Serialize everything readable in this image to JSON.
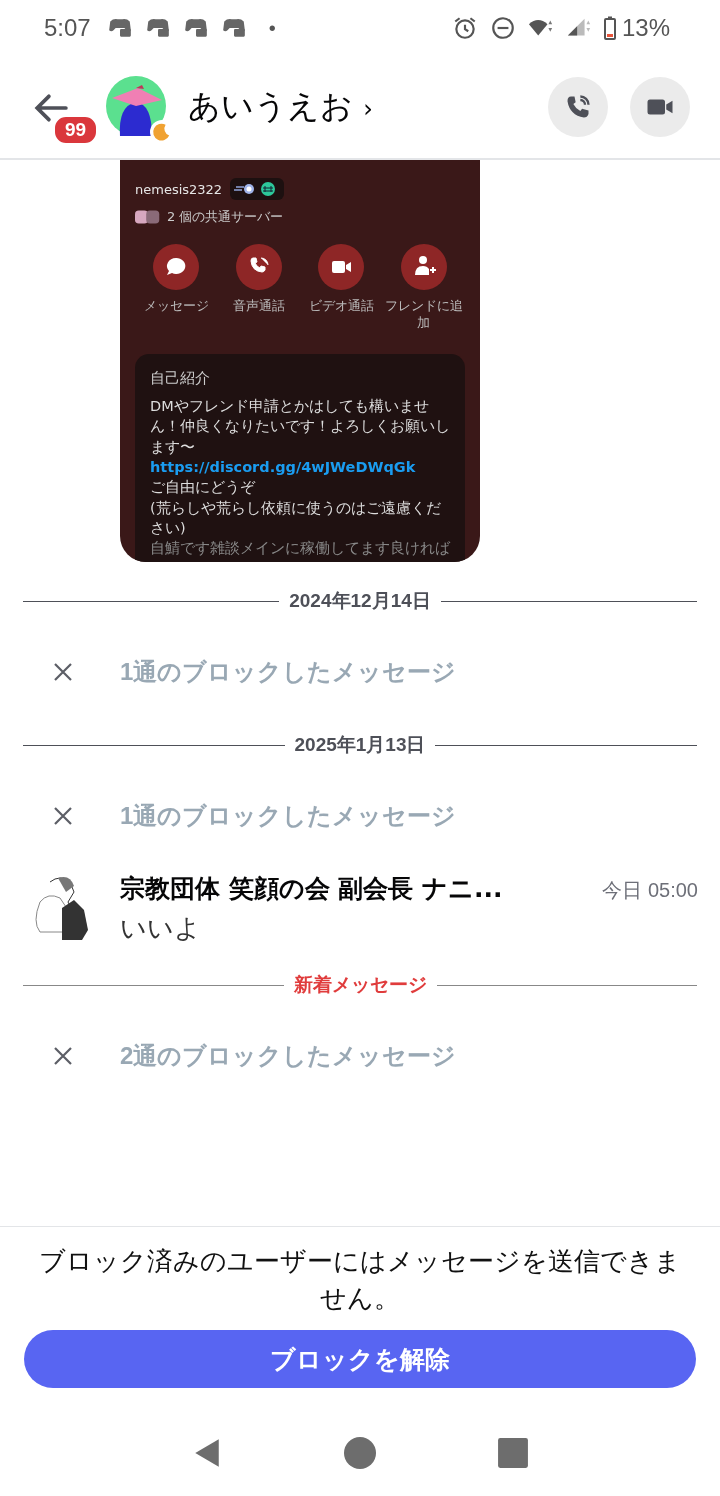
{
  "status_bar": {
    "time": "5:07",
    "dot": "•",
    "battery": "13%"
  },
  "header": {
    "unread_badge": "99",
    "title": "あいうえお",
    "chevron": "›"
  },
  "shared_screenshot": {
    "username": "nemesis2322",
    "mutual_servers": "2 個の共通サーバー",
    "actions": [
      {
        "kind": "message",
        "label": "メッセージ"
      },
      {
        "kind": "call",
        "label": "音声通話"
      },
      {
        "kind": "video",
        "label": "ビデオ通話"
      },
      {
        "kind": "add_friend",
        "label": "フレンドに追加"
      }
    ],
    "bio_title": "自己紹介",
    "bio": [
      {
        "kind": "text",
        "text": "DMやフレンド申請とかはしても構いません！仲良くなりたいです！よろしくお願いします〜"
      },
      {
        "kind": "link",
        "text": "https://discord.gg/4wJWeDWqGk"
      },
      {
        "kind": "text",
        "text": "ご自由にどうぞ"
      },
      {
        "kind": "text",
        "text": "(荒らしや荒らし依頼に使うのはご遠慮ください)"
      },
      {
        "kind": "dim",
        "text": "自鯖です雑談メインに稼働してます良ければ"
      }
    ]
  },
  "timeline": [
    {
      "kind": "date",
      "text": "2024年12月14日"
    },
    {
      "kind": "blocked",
      "text": "1通のブロックしたメッセージ"
    },
    {
      "kind": "date",
      "text": "2025年1月13日"
    },
    {
      "kind": "blocked",
      "text": "1通のブロックしたメッセージ"
    },
    {
      "kind": "message",
      "author": "宗教団体 笑顔の会 副会長 ナニ...",
      "time": "今日 05:00",
      "text": "いいよ"
    },
    {
      "kind": "new",
      "text": "新着メッセージ"
    },
    {
      "kind": "blocked",
      "text": "2通のブロックしたメッセージ"
    }
  ],
  "footer": {
    "notice": "ブロック済みのユーザーにはメッセージを送信できません。",
    "button": "ブロックを解除"
  }
}
